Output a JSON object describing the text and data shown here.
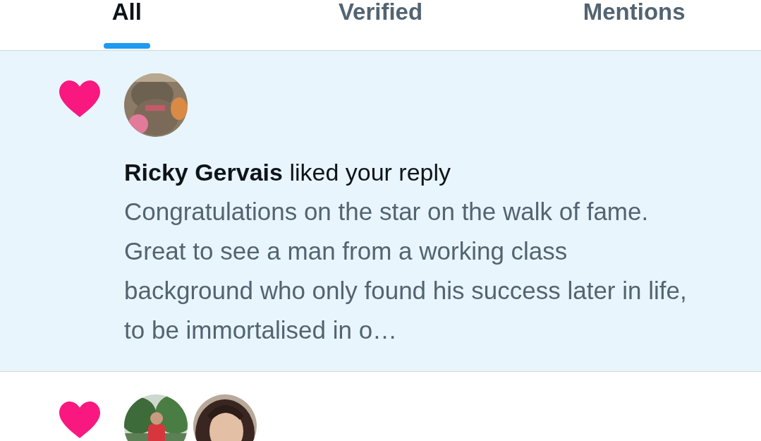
{
  "tabs": [
    {
      "label": "All",
      "selected": true
    },
    {
      "label": "Verified",
      "selected": false
    },
    {
      "label": "Mentions",
      "selected": false
    }
  ],
  "notifications": [
    {
      "kind": "like",
      "unread": true,
      "headline": "**Ricky Gervais** liked your reply",
      "text": "Congratulations on the star on the walk of fame. Great to see a man from a working class background who only found his success later in life, to be immortalised in o…"
    },
    {
      "kind": "like",
      "unread": false
    }
  ]
}
